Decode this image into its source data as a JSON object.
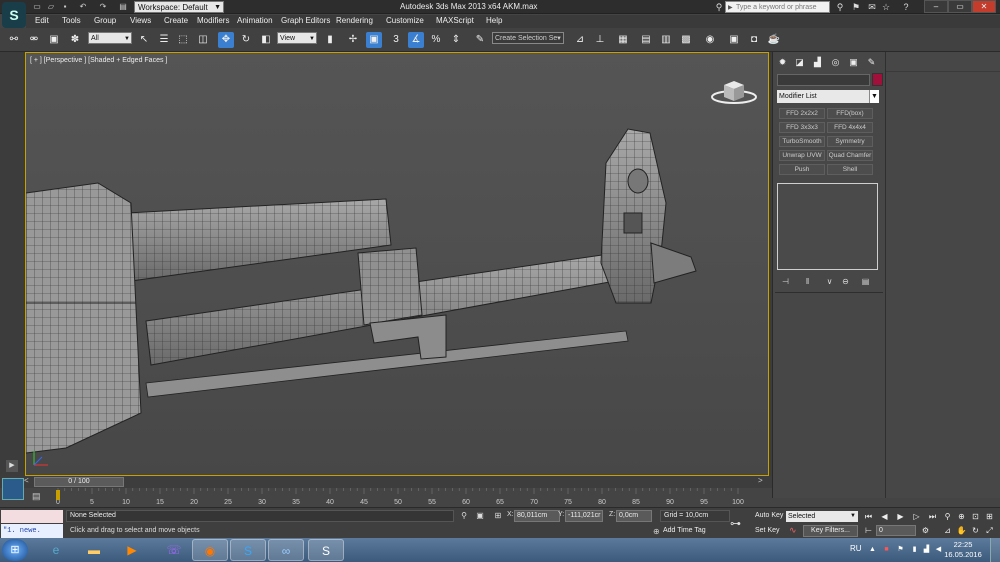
{
  "window": {
    "title": "Autodesk 3ds Max  2013 x64      AKM.max",
    "workspace": "Workspace: Default",
    "search_placeholder": "Type a keyword or phrase"
  },
  "menu": [
    "Edit",
    "Tools",
    "Group",
    "Views",
    "Create",
    "Modifiers",
    "Animation",
    "Graph Editors",
    "Rendering",
    "Customize",
    "MAXScript",
    "Help"
  ],
  "toolbar": {
    "selection_filter": "All",
    "ref_coord": "View",
    "snap_label": "3",
    "named_selection_set": "Create Selection Se"
  },
  "viewport": {
    "label": "[ + ] [Perspective ] [Shaded + Edged Faces ]"
  },
  "command_panel": {
    "modifier_list": "Modifier List",
    "modifier_buttons": [
      "FFD 2x2x2",
      "FFD(box)",
      "FFD 3x3x3",
      "FFD 4x4x4",
      "TurboSmooth",
      "Symmetry",
      "Unwrap UVW",
      "Quad Chamfer",
      "Push",
      "Shell"
    ],
    "object_color": "#a0103a"
  },
  "timeline": {
    "frame_display": "0 / 100",
    "ticks": [
      "0",
      "5",
      "10",
      "15",
      "20",
      "25",
      "30",
      "35",
      "40",
      "45",
      "50",
      "55",
      "60",
      "65",
      "70",
      "75",
      "80",
      "85",
      "90",
      "95",
      "100"
    ]
  },
  "status": {
    "listener_top": "",
    "listener_text": "\"1.   newe.",
    "selection_status": "None Selected",
    "prompt": "Click and drag to select and move objects",
    "x_value": "80,011cm",
    "y_value": "-111,021cr",
    "z_value": "0,0cm",
    "grid": "Grid = 10,0cm",
    "add_time_tag": "Add Time Tag",
    "auto_key": "Auto Key",
    "set_key": "Set Key",
    "selected_dropdown": "Selected",
    "key_filters": "Key Filters...",
    "current_frame": "0",
    "x_label": "X:",
    "y_label": "Y:",
    "z_label": "Z:"
  },
  "taskbar": {
    "language": "RU",
    "time": "22:25",
    "date": "16.05.2016"
  }
}
